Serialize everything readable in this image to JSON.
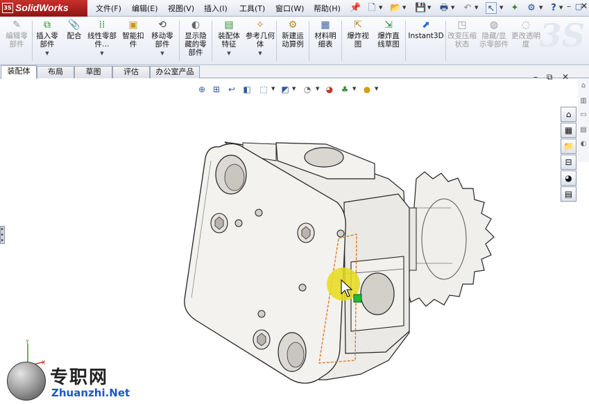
{
  "app": {
    "name": "SolidWorks",
    "logo_text": "3S"
  },
  "menu": [
    "文件(F)",
    "编辑(E)",
    "视图(V)",
    "插入(I)",
    "工具(T)",
    "窗口(W)",
    "帮助(H)"
  ],
  "quick_icons": [
    "pin-icon",
    "new-document-icon",
    "open-icon",
    "save-icon",
    "print-icon",
    "undo-icon",
    "select-icon",
    "rebuild-icon",
    "options-icon",
    "help-icon"
  ],
  "quick_help": "?",
  "window_buttons": {
    "minimize": "–",
    "restore": "▢",
    "close": "✕"
  },
  "toolbar": {
    "edit_part": "编辑零部件",
    "insert_component": "插入零部件",
    "mate": "配合",
    "linear_pattern": "线性零部件…",
    "smart_fasteners": "智能扣件",
    "move_component": "移动零部件",
    "show_hidden": "显示隐藏的零部件",
    "assembly_features": "装配体特征",
    "reference_geometry": "参考几何体",
    "new_motion_study": "新建运动算例",
    "bill_of_materials": "材料明细表",
    "exploded_view": "爆炸视图",
    "explode_line_sketch": "爆炸直线草图",
    "instant3d": "Instant3D",
    "change_suppression": "改变压缩状态",
    "hide_show_components": "隐藏/显示零部件",
    "change_transparency": "更改透明度",
    "watermark": "3S"
  },
  "tabs": [
    "装配体",
    "布局",
    "草图",
    "评估",
    "办公室产品"
  ],
  "active_tab": "装配体",
  "viewport_window": {
    "minimize": "–",
    "restore": "⧉",
    "close": "✕"
  },
  "heads_up_icons": [
    "zoom-to-fit-icon",
    "zoom-area-icon",
    "previous-view-icon",
    "section-view-icon",
    "view-orientation-icon",
    "display-style-icon",
    "hide-show-items-icon",
    "edit-appearance-icon",
    "apply-scene-icon",
    "view-settings-icon"
  ],
  "task_pane": [
    "home-icon",
    "design-library-icon",
    "file-explorer-icon",
    "view-palette-icon",
    "appearances-icon",
    "custom-properties-icon"
  ],
  "triad": {
    "x": "X",
    "y": "Y"
  },
  "watermark": {
    "cn": "专职网",
    "en": "Zhuanzhi.Net"
  },
  "colors": {
    "brand": "#b1201c",
    "part": "#efedea",
    "selection": "#e07a1f",
    "handle": "#22bb33",
    "cursor_halo": "#e8dc1a"
  }
}
